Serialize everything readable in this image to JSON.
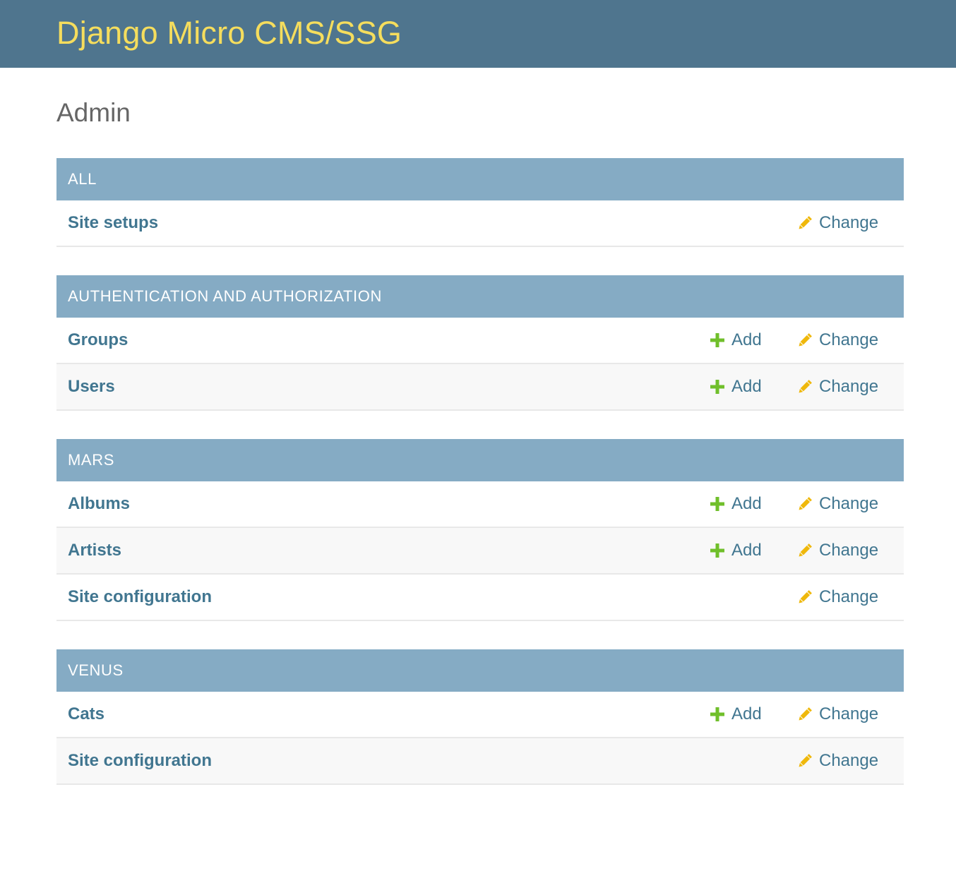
{
  "header": {
    "site_name": "Django Micro CMS/SSG"
  },
  "page": {
    "title": "Admin"
  },
  "colors": {
    "header_bg": "#4f758e",
    "site_name": "#f5dd5d",
    "caption_bg": "#85abc4",
    "link": "#417690",
    "add_icon": "#70bf2b",
    "change_icon": "#efb80b"
  },
  "icons": {
    "add": "plus-icon",
    "change": "pencil-icon"
  },
  "modules": [
    {
      "caption": "All",
      "rows": [
        {
          "name": "Site setups",
          "add_label": null,
          "change_label": "Change"
        }
      ]
    },
    {
      "caption": "Authentication and Authorization",
      "rows": [
        {
          "name": "Groups",
          "add_label": "Add",
          "change_label": "Change"
        },
        {
          "name": "Users",
          "add_label": "Add",
          "change_label": "Change"
        }
      ]
    },
    {
      "caption": "Mars",
      "rows": [
        {
          "name": "Albums",
          "add_label": "Add",
          "change_label": "Change"
        },
        {
          "name": "Artists",
          "add_label": "Add",
          "change_label": "Change"
        },
        {
          "name": "Site configuration",
          "add_label": null,
          "change_label": "Change"
        }
      ]
    },
    {
      "caption": "Venus",
      "rows": [
        {
          "name": "Cats",
          "add_label": "Add",
          "change_label": "Change"
        },
        {
          "name": "Site configuration",
          "add_label": null,
          "change_label": "Change"
        }
      ]
    }
  ]
}
